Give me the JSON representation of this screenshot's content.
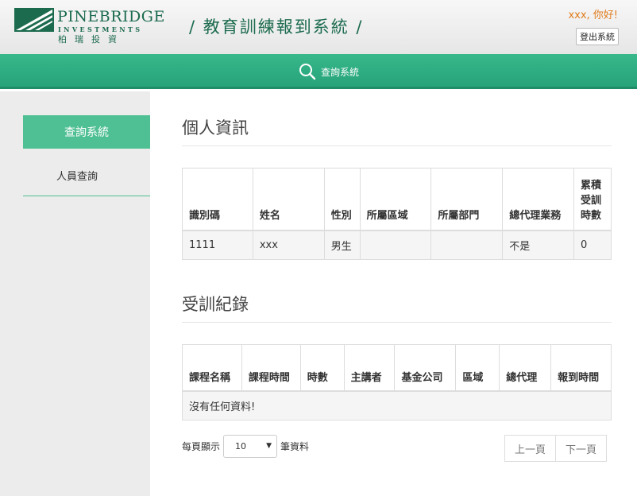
{
  "header": {
    "logo_name": "PINEBRIDGE",
    "logo_sub": "INVESTMENTS",
    "logo_cn": "柏瑞投資",
    "system_title": "/ 教育訓練報到系統 /",
    "greeting": "xxx, 你好!",
    "logout_label": "登出系統",
    "brand_color": "#1c6b4e"
  },
  "nav": {
    "query_label": "查詢系統",
    "icon": "search-icon",
    "accent_color": "#27a37a"
  },
  "sidebar": {
    "active_label": "查詢系統",
    "items": [
      {
        "label": "人員查詢"
      }
    ]
  },
  "personal": {
    "title": "個人資訊",
    "headers": [
      "識別碼",
      "姓名",
      "性別",
      "所屬區域",
      "所屬部門",
      "總代理業務",
      "累積受訓時數"
    ],
    "rows": [
      [
        "1111",
        "xxx",
        "男生",
        "",
        "",
        "不是",
        "0"
      ]
    ]
  },
  "training": {
    "title": "受訓紀錄",
    "headers": [
      "課程名稱",
      "課程時間",
      "時數",
      "主講者",
      "基金公司",
      "區域",
      "總代理",
      "報到時間"
    ],
    "empty_message": "沒有任何資料!"
  },
  "pagination": {
    "per_page_prefix": "每頁顯示",
    "per_page_value": "10",
    "per_page_suffix": "筆資料",
    "prev_label": "上一頁",
    "next_label": "下一頁"
  }
}
